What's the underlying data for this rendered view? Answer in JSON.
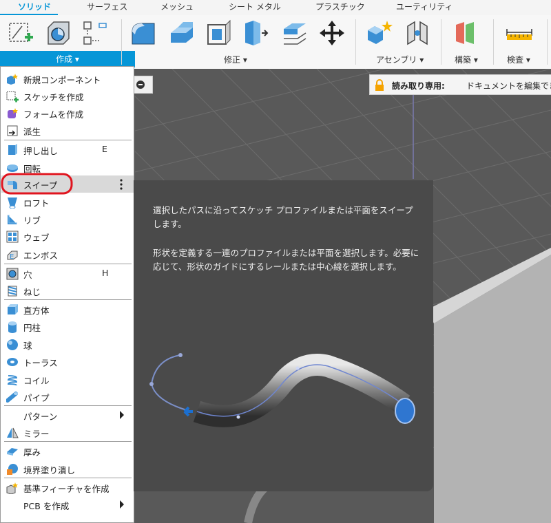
{
  "tabs": [
    "ソリッド",
    "サーフェス",
    "メッシュ",
    "シート メタル",
    "プラスチック",
    "ユーティリティ"
  ],
  "toolbar": {
    "create_label": "作成 ▾",
    "modify_label": "修正 ▾",
    "assemble_label": "アセンブリ ▾",
    "construct_label": "構築 ▾",
    "inspect_label": "検査 ▾"
  },
  "readonly": {
    "title": "読み取り専用:",
    "message": "ドキュメントを編集でき"
  },
  "menu": {
    "items": [
      {
        "label": "新規コンポーネント",
        "icon": "new-component-icon"
      },
      {
        "label": "スケッチを作成",
        "icon": "create-sketch-icon"
      },
      {
        "label": "フォームを作成",
        "icon": "create-form-icon"
      },
      {
        "label": "派生",
        "icon": "derive-icon"
      },
      {
        "label": "押し出し",
        "shortcut": "E",
        "icon": "extrude-icon"
      },
      {
        "label": "回転",
        "icon": "revolve-icon"
      },
      {
        "label": "スイープ",
        "icon": "sweep-icon"
      },
      {
        "label": "ロフト",
        "icon": "loft-icon"
      },
      {
        "label": "リブ",
        "icon": "rib-icon"
      },
      {
        "label": "ウェブ",
        "icon": "web-icon"
      },
      {
        "label": "エンボス",
        "icon": "emboss-icon"
      },
      {
        "label": "穴",
        "shortcut": "H",
        "icon": "hole-icon"
      },
      {
        "label": "ねじ",
        "icon": "thread-icon"
      },
      {
        "label": "直方体",
        "icon": "box-icon"
      },
      {
        "label": "円柱",
        "icon": "cylinder-icon"
      },
      {
        "label": "球",
        "icon": "sphere-icon"
      },
      {
        "label": "トーラス",
        "icon": "torus-icon"
      },
      {
        "label": "コイル",
        "icon": "coil-icon"
      },
      {
        "label": "パイプ",
        "icon": "pipe-icon"
      },
      {
        "label": "パターン",
        "icon": "pattern-icon"
      },
      {
        "label": "ミラー",
        "icon": "mirror-icon"
      },
      {
        "label": "厚み",
        "icon": "thicken-icon"
      },
      {
        "label": "境界塗り潰し",
        "icon": "boundary-fill-icon"
      },
      {
        "label": "基準フィーチャを作成",
        "icon": "base-feature-icon"
      },
      {
        "label": "PCB を作成",
        "icon": "pcb-icon"
      }
    ]
  },
  "tooltip": {
    "line1": "選択したパスに沿ってスケッチ プロファイルまたは平面をスイープします。",
    "line2": "形状を定義する一連のプロファイルまたは平面を選択します。必要に応じて、形状のガイドにするレールまたは中心線を選択します。"
  },
  "colors": {
    "accent": "#0696d7",
    "highlight_ring": "#e0141e",
    "tooltip_bg": "#4a4a4a"
  }
}
